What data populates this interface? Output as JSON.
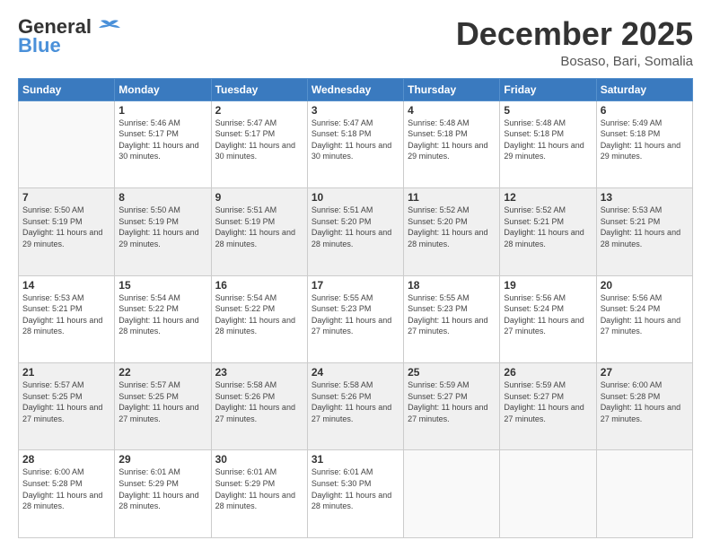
{
  "header": {
    "logo": {
      "line1": "General",
      "line2": "Blue"
    },
    "title": "December 2025",
    "location": "Bosaso, Bari, Somalia"
  },
  "calendar": {
    "days_of_week": [
      "Sunday",
      "Monday",
      "Tuesday",
      "Wednesday",
      "Thursday",
      "Friday",
      "Saturday"
    ],
    "weeks": [
      [
        {
          "day": "",
          "sunrise": "",
          "sunset": "",
          "daylight": "",
          "empty": true
        },
        {
          "day": "1",
          "sunrise": "5:46 AM",
          "sunset": "5:17 PM",
          "daylight": "11 hours and 30 minutes."
        },
        {
          "day": "2",
          "sunrise": "5:47 AM",
          "sunset": "5:17 PM",
          "daylight": "11 hours and 30 minutes."
        },
        {
          "day": "3",
          "sunrise": "5:47 AM",
          "sunset": "5:18 PM",
          "daylight": "11 hours and 30 minutes."
        },
        {
          "day": "4",
          "sunrise": "5:48 AM",
          "sunset": "5:18 PM",
          "daylight": "11 hours and 29 minutes."
        },
        {
          "day": "5",
          "sunrise": "5:48 AM",
          "sunset": "5:18 PM",
          "daylight": "11 hours and 29 minutes."
        },
        {
          "day": "6",
          "sunrise": "5:49 AM",
          "sunset": "5:18 PM",
          "daylight": "11 hours and 29 minutes."
        }
      ],
      [
        {
          "day": "7",
          "sunrise": "5:50 AM",
          "sunset": "5:19 PM",
          "daylight": "11 hours and 29 minutes."
        },
        {
          "day": "8",
          "sunrise": "5:50 AM",
          "sunset": "5:19 PM",
          "daylight": "11 hours and 29 minutes."
        },
        {
          "day": "9",
          "sunrise": "5:51 AM",
          "sunset": "5:19 PM",
          "daylight": "11 hours and 28 minutes."
        },
        {
          "day": "10",
          "sunrise": "5:51 AM",
          "sunset": "5:20 PM",
          "daylight": "11 hours and 28 minutes."
        },
        {
          "day": "11",
          "sunrise": "5:52 AM",
          "sunset": "5:20 PM",
          "daylight": "11 hours and 28 minutes."
        },
        {
          "day": "12",
          "sunrise": "5:52 AM",
          "sunset": "5:21 PM",
          "daylight": "11 hours and 28 minutes."
        },
        {
          "day": "13",
          "sunrise": "5:53 AM",
          "sunset": "5:21 PM",
          "daylight": "11 hours and 28 minutes."
        }
      ],
      [
        {
          "day": "14",
          "sunrise": "5:53 AM",
          "sunset": "5:21 PM",
          "daylight": "11 hours and 28 minutes."
        },
        {
          "day": "15",
          "sunrise": "5:54 AM",
          "sunset": "5:22 PM",
          "daylight": "11 hours and 28 minutes."
        },
        {
          "day": "16",
          "sunrise": "5:54 AM",
          "sunset": "5:22 PM",
          "daylight": "11 hours and 28 minutes."
        },
        {
          "day": "17",
          "sunrise": "5:55 AM",
          "sunset": "5:23 PM",
          "daylight": "11 hours and 27 minutes."
        },
        {
          "day": "18",
          "sunrise": "5:55 AM",
          "sunset": "5:23 PM",
          "daylight": "11 hours and 27 minutes."
        },
        {
          "day": "19",
          "sunrise": "5:56 AM",
          "sunset": "5:24 PM",
          "daylight": "11 hours and 27 minutes."
        },
        {
          "day": "20",
          "sunrise": "5:56 AM",
          "sunset": "5:24 PM",
          "daylight": "11 hours and 27 minutes."
        }
      ],
      [
        {
          "day": "21",
          "sunrise": "5:57 AM",
          "sunset": "5:25 PM",
          "daylight": "11 hours and 27 minutes."
        },
        {
          "day": "22",
          "sunrise": "5:57 AM",
          "sunset": "5:25 PM",
          "daylight": "11 hours and 27 minutes."
        },
        {
          "day": "23",
          "sunrise": "5:58 AM",
          "sunset": "5:26 PM",
          "daylight": "11 hours and 27 minutes."
        },
        {
          "day": "24",
          "sunrise": "5:58 AM",
          "sunset": "5:26 PM",
          "daylight": "11 hours and 27 minutes."
        },
        {
          "day": "25",
          "sunrise": "5:59 AM",
          "sunset": "5:27 PM",
          "daylight": "11 hours and 27 minutes."
        },
        {
          "day": "26",
          "sunrise": "5:59 AM",
          "sunset": "5:27 PM",
          "daylight": "11 hours and 27 minutes."
        },
        {
          "day": "27",
          "sunrise": "6:00 AM",
          "sunset": "5:28 PM",
          "daylight": "11 hours and 27 minutes."
        }
      ],
      [
        {
          "day": "28",
          "sunrise": "6:00 AM",
          "sunset": "5:28 PM",
          "daylight": "11 hours and 28 minutes."
        },
        {
          "day": "29",
          "sunrise": "6:01 AM",
          "sunset": "5:29 PM",
          "daylight": "11 hours and 28 minutes."
        },
        {
          "day": "30",
          "sunrise": "6:01 AM",
          "sunset": "5:29 PM",
          "daylight": "11 hours and 28 minutes."
        },
        {
          "day": "31",
          "sunrise": "6:01 AM",
          "sunset": "5:30 PM",
          "daylight": "11 hours and 28 minutes."
        },
        {
          "day": "",
          "sunrise": "",
          "sunset": "",
          "daylight": "",
          "empty": true
        },
        {
          "day": "",
          "sunrise": "",
          "sunset": "",
          "daylight": "",
          "empty": true
        },
        {
          "day": "",
          "sunrise": "",
          "sunset": "",
          "daylight": "",
          "empty": true
        }
      ]
    ]
  }
}
